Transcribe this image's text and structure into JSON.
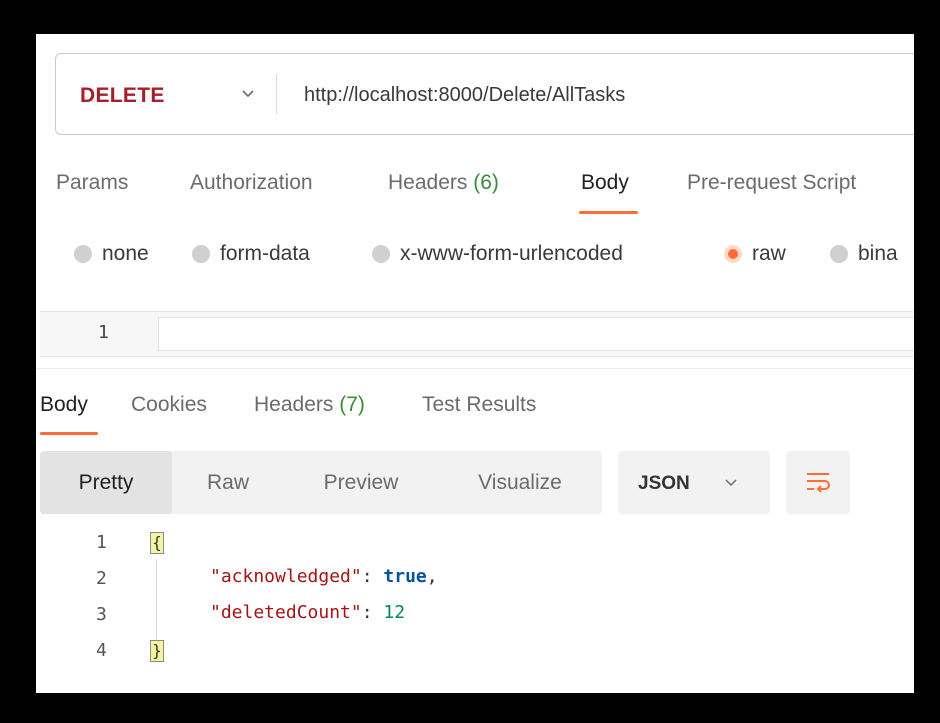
{
  "request": {
    "method": "DELETE",
    "url": "http://localhost:8000/Delete/AllTasks"
  },
  "request_tabs": {
    "params": "Params",
    "authorization": "Authorization",
    "headers_label": "Headers",
    "headers_count": "(6)",
    "body": "Body",
    "prerequest": "Pre-request Script"
  },
  "body_types": {
    "none": "none",
    "form_data": "form-data",
    "urlencoded": "x-www-form-urlencoded",
    "raw": "raw",
    "binary": "bina"
  },
  "request_editor": {
    "line_number": "1"
  },
  "response_tabs": {
    "body": "Body",
    "cookies": "Cookies",
    "headers_label": "Headers",
    "headers_count": "(7)",
    "test_results": "Test Results"
  },
  "view_modes": {
    "pretty": "Pretty",
    "raw": "Raw",
    "preview": "Preview",
    "visualize": "Visualize"
  },
  "format": {
    "selected": "JSON"
  },
  "response": {
    "line_numbers": [
      "1",
      "2",
      "3",
      "4"
    ],
    "open_brace": "{",
    "close_brace": "}",
    "key1": "\"acknowledged\"",
    "val1": "true",
    "key2": "\"deletedCount\"",
    "val2": "12"
  },
  "colors": {
    "method": "#a5202c",
    "accent": "#ff6c37",
    "count": "#3b8a3b"
  }
}
